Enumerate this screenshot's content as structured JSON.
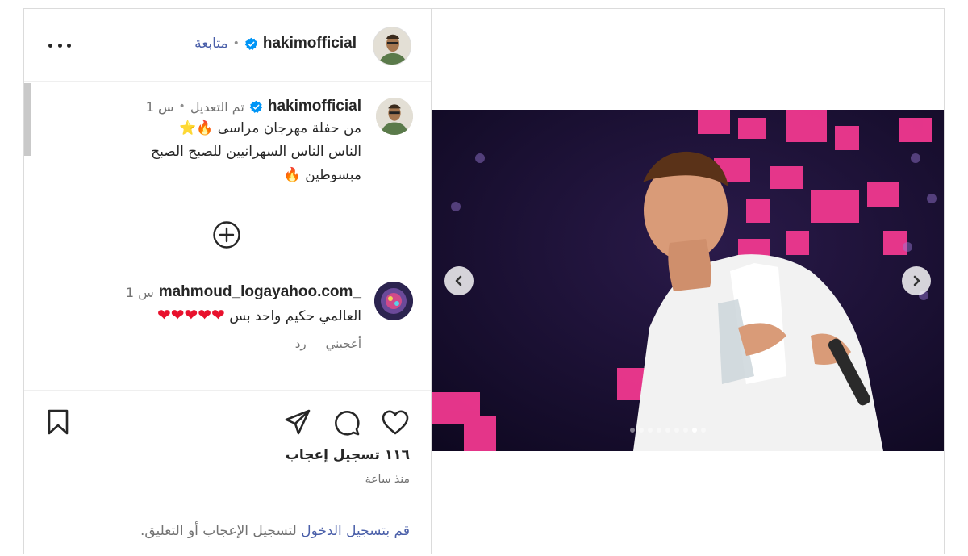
{
  "header": {
    "username": "hakimofficial",
    "separator": "•",
    "follow_label": "متابعة"
  },
  "caption": {
    "username": "hakimofficial",
    "edited_label": "تم التعديل",
    "separator": "•",
    "time": "1 س",
    "lines": [
      "من حفلة مهرجان مراسى",
      "الناس الناس السهرانيين للصبح الصبح",
      "مبسوطين"
    ],
    "emoji": {
      "fire": "🔥",
      "star": "⭐"
    }
  },
  "comment": {
    "username": "mahmoud_logayahoo.com_",
    "time": "1 س",
    "text": "العالمي حكيم واحد بس",
    "hearts": "❤❤❤❤❤",
    "like_label": "أعجبني",
    "reply_label": "رد"
  },
  "actions": {
    "likes_count": "١١٦ تسجيل إعجاب",
    "time_ago": "منذ ساعة",
    "login_link": "قم بتسجيل الدخول",
    "login_rest": "لتسجيل الإعجاب أو التعليق."
  },
  "carousel": {
    "slide_count": 9,
    "active_index": 7
  },
  "colors": {
    "link": "#4a5fa9",
    "verified": "#0095f6",
    "heart": "#e8112d",
    "muted": "#737373",
    "text": "#262626"
  },
  "icons": [
    "more-icon",
    "verified-icon",
    "plus-circle-icon",
    "bookmark-icon",
    "share-icon",
    "comment-icon",
    "like-icon",
    "chevron-left-icon",
    "chevron-right-icon"
  ]
}
